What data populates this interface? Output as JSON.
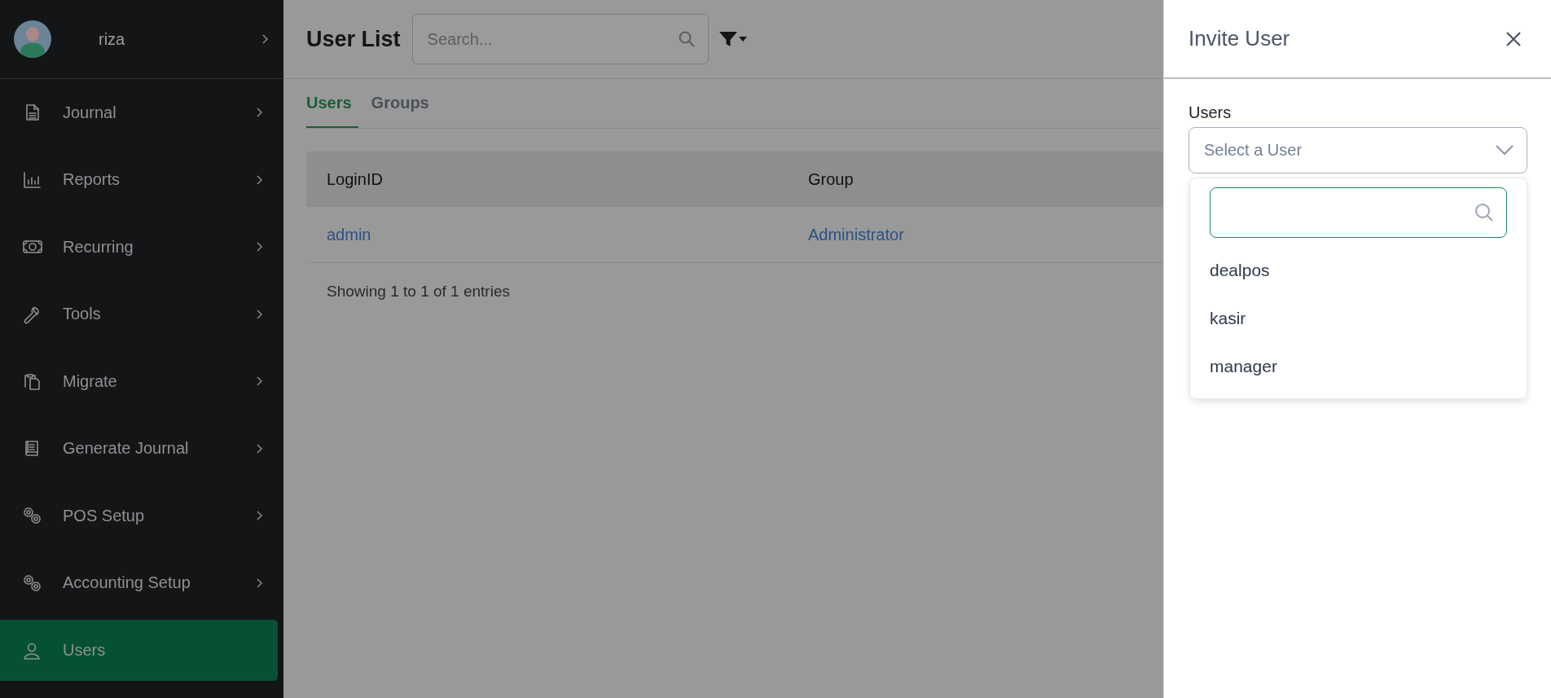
{
  "user": {
    "name": "riza"
  },
  "sidebar": {
    "items": [
      {
        "label": "Journal",
        "selected": false,
        "expandable": true
      },
      {
        "label": "Reports",
        "selected": false,
        "expandable": true
      },
      {
        "label": "Recurring",
        "selected": false,
        "expandable": true
      },
      {
        "label": "Tools",
        "selected": false,
        "expandable": true
      },
      {
        "label": "Migrate",
        "selected": false,
        "expandable": true
      },
      {
        "label": "Generate Journal",
        "selected": false,
        "expandable": true
      },
      {
        "label": "POS Setup",
        "selected": false,
        "expandable": true
      },
      {
        "label": "Accounting Setup",
        "selected": false,
        "expandable": true
      },
      {
        "label": "Users",
        "selected": true,
        "expandable": false
      }
    ]
  },
  "page": {
    "title": "User List",
    "search": {
      "placeholder": "Search..."
    }
  },
  "tabs": [
    {
      "label": "Users",
      "selected": true
    },
    {
      "label": "Groups",
      "selected": false
    }
  ],
  "table": {
    "columns": [
      "LoginID",
      "Group"
    ],
    "rows": [
      [
        "admin",
        "Administrator"
      ]
    ],
    "footer": "Showing 1 to 1 of 1 entries"
  },
  "drawer": {
    "title": "Invite User",
    "field_label": "Users",
    "select": {
      "placeholder": "Select a User",
      "expanded": true
    },
    "options": [
      {
        "label": "dealpos"
      },
      {
        "label": "kasir"
      },
      {
        "label": "manager"
      }
    ]
  }
}
